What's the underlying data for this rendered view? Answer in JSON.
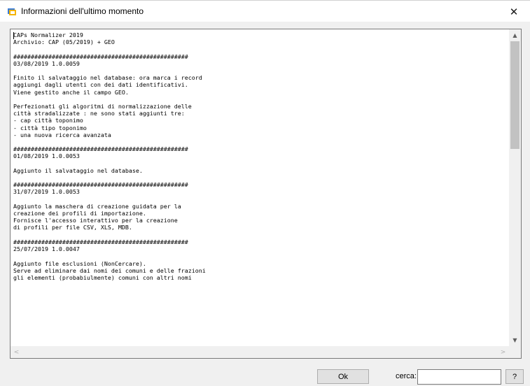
{
  "window": {
    "title": "Informazioni dell'ultimo momento",
    "close_glyph": "✕",
    "icon": "app-icon"
  },
  "release_notes": {
    "lines": [
      "CAPs Normalizer 2019",
      "Archivio: CAP (05/2019) + GEO",
      "",
      "##################################################",
      "03/08/2019 1.0.0059",
      "",
      "Finito il salvataggio nel database: ora marca i record",
      "aggiungi dagli utenti con dei dati identificativi.",
      "Viene gestito anche il campo GEO.",
      "",
      "Perfezionati gli algoritmi di normalizzazione delle",
      "città stradalizzate : ne sono stati aggiunti tre:",
      "- cap città toponimo",
      "- città tipo toponimo",
      "- una nuova ricerca avanzata",
      "",
      "##################################################",
      "01/08/2019 1.0.0053",
      "",
      "Aggiunto il salvataggio nel database.",
      "",
      "##################################################",
      "31/07/2019 1.0.0053",
      "",
      "Aggiunto la maschera di creazione guidata per la",
      "creazione dei profili di importazione.",
      "Fornisce l'accesso interattivo per la creazione",
      "di profili per file CSV, XLS, MDB.",
      "",
      "##################################################",
      "25/07/2019 1.0.0047",
      "",
      "Aggiunto file esclusioni (NonCercare).",
      "Serve ad eliminare dai nomi dei comuni e delle frazioni",
      "gli elementi (probabiulmente) comuni con altri nomi"
    ]
  },
  "scrollbars": {
    "up": "▲",
    "down": "▼",
    "left": "<",
    "right": ">"
  },
  "footer": {
    "ok_label": "Ok",
    "search_label": "cerca:",
    "search_value": "",
    "help_label": "?"
  },
  "colors": {
    "dialog_bg": "#f0f0f0",
    "button_bg": "#e1e1e1",
    "scroll_thumb": "#c2c2c2"
  }
}
